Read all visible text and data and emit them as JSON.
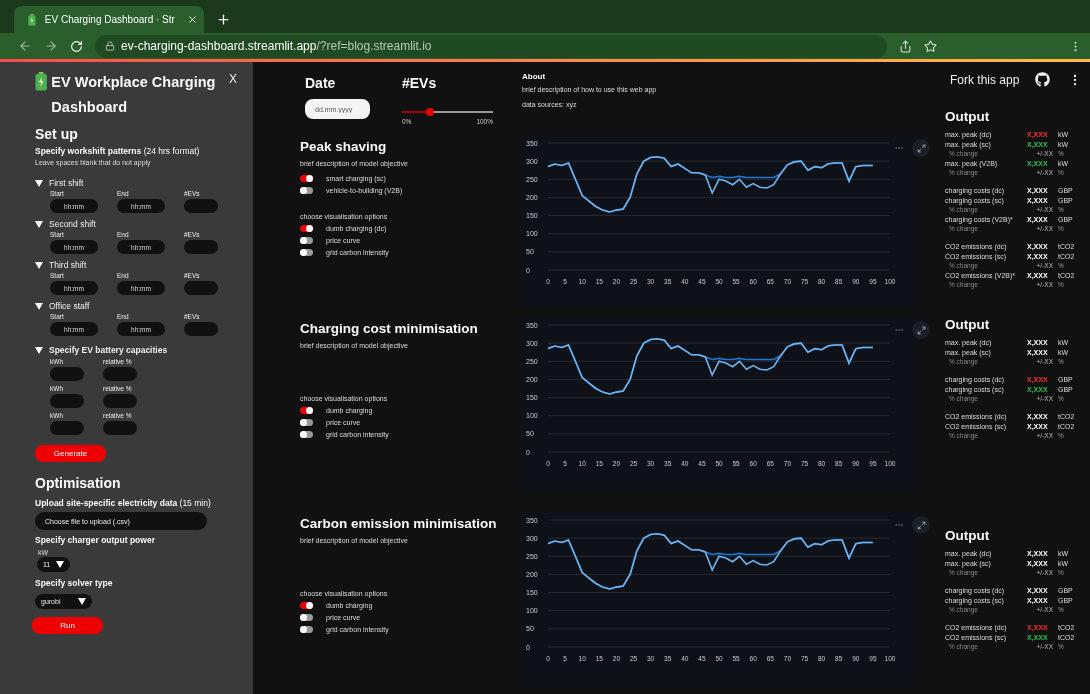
{
  "browser": {
    "tab_title": "EV Charging  Dashboard · Str",
    "url_host": "ev-charging-dashboard.streamlit.app",
    "url_path": "/?ref=blog.streamlit.io"
  },
  "sidebar": {
    "title": "EV Workplace Charging Dashboard",
    "close_label": "X",
    "setup_heading": "Set up",
    "workshift_label": "**Specify workshift patterns** (24 hrs format)",
    "workshift_hint": "Leave spaces blank that do not apply",
    "shifts": [
      {
        "name": "First shift",
        "expanded": true,
        "fields": [
          {
            "label": "Start",
            "placeholder": "hh:mm"
          },
          {
            "label": "End",
            "placeholder": "hh:mm"
          },
          {
            "label": "#EVs"
          }
        ]
      },
      {
        "name": "Second shift",
        "expanded": true,
        "fields": [
          {
            "label": "Start",
            "placeholder": "hh:mm"
          },
          {
            "label": "End",
            "placeholder": "hh:mm"
          },
          {
            "label": "#EVs"
          }
        ]
      },
      {
        "name": "Third shift",
        "expanded": true,
        "fields": [
          {
            "label": "Start",
            "placeholder": "hh:mm"
          },
          {
            "label": "End",
            "placeholder": "hh:mm"
          },
          {
            "label": "#EVs"
          }
        ]
      },
      {
        "name": "Office staff",
        "expanded": true,
        "fields": [
          {
            "label": "Start",
            "placeholder": "hh:mm"
          },
          {
            "label": "End",
            "placeholder": "hh:mm"
          },
          {
            "label": "#EVs"
          }
        ]
      }
    ],
    "battery": {
      "title": "Specify EV battery capacities",
      "expanded": true,
      "rows": [
        {
          "fields": [
            {
              "label": "kWh"
            },
            {
              "label": "relative %"
            }
          ]
        },
        {
          "fields": [
            {
              "label": "kWh"
            },
            {
              "label": "relative %"
            }
          ]
        },
        {
          "fields": [
            {
              "label": "kWh"
            },
            {
              "label": "relative %"
            }
          ]
        }
      ]
    },
    "generate_button": "Generate",
    "optimisation_heading": "Optimisation",
    "upload_label": "**Upload site-specific electricity data** (15 min)",
    "upload_button": "Choose file to upload (.csv)",
    "power_label": "Specify charger output power",
    "power_unit": "kW",
    "power_value": "11",
    "solver_label": "Specify solver type",
    "solver_value": "gurobi",
    "run_button": "Run"
  },
  "header": {
    "date_label": "Date",
    "date_placeholder": "dd.mm.yyyy",
    "evs_label": "#EVs",
    "evs_slider": {
      "level": 0.31,
      "min_label": "0%",
      "max_label": "100%"
    },
    "about_title": "About",
    "about_text": "brief description of how to use this web app",
    "about_sources": "data sources: xyz",
    "fork_label": "Fork this app"
  },
  "sections": [
    {
      "title": "Peak shaving",
      "description": "brief description of model objective",
      "options": [
        {
          "label": "smart charging (sc)",
          "on": true
        },
        {
          "label": "vehicle-to-building (V2B)",
          "on": false
        }
      ],
      "visualisation_heading": "choose visualisation options",
      "visualisation_options": [
        {
          "label": "dumb charging (dc)",
          "on": true
        },
        {
          "label": "price curve",
          "on": false
        },
        {
          "label": "grid carbon intensity",
          "on": false
        }
      ],
      "chart_data": {
        "type": "line",
        "x": [
          0,
          2,
          4,
          6,
          8,
          10,
          12,
          14,
          16,
          18,
          20,
          22,
          24,
          26,
          28,
          30,
          32,
          34,
          36,
          38,
          40,
          42,
          44,
          46,
          48,
          50,
          52,
          54,
          56,
          58,
          60,
          62,
          64,
          66,
          68,
          70,
          72,
          74,
          76,
          78,
          80,
          82,
          84,
          86,
          88,
          90,
          92,
          95
        ],
        "series": [
          {
            "color": "#1f77d0",
            "values": [
              285,
              292,
              288,
              295,
              250,
              205,
              190,
              175,
              165,
              160,
              165,
              168,
              200,
              265,
              300,
              310,
              312,
              308,
              285,
              292,
              280,
              268,
              268,
              262,
              255,
              258,
              255,
              255,
              258,
              255,
              255,
              255,
              255,
              255,
              265,
              290,
              298,
              300,
              275,
              285,
              282,
              293,
              295,
              295,
              245,
              285,
              288,
              288
            ]
          },
          {
            "color": "#6cb4ee",
            "values": [
              285,
              292,
              288,
              295,
              250,
              205,
              190,
              175,
              165,
              160,
              165,
              168,
              200,
              265,
              300,
              310,
              312,
              308,
              285,
              292,
              280,
              268,
              268,
              262,
              212,
              250,
              245,
              235,
              250,
              228,
              238,
              228,
              226,
              235,
              265,
              290,
              298,
              300,
              275,
              285,
              282,
              293,
              295,
              295,
              245,
              285,
              288,
              288
            ]
          }
        ],
        "xlim": [
          0,
          100
        ],
        "ylim": [
          0,
          350
        ],
        "xticks": [
          0,
          5,
          10,
          15,
          20,
          25,
          30,
          35,
          40,
          45,
          50,
          55,
          60,
          65,
          70,
          75,
          80,
          85,
          90,
          95,
          100
        ],
        "yticks": [
          0,
          50,
          100,
          150,
          200,
          250,
          300,
          350
        ],
        "grid": true
      }
    },
    {
      "title": "Charging cost minimisation",
      "description": "brief description of model objective",
      "visualisation_heading": "choose visualisation options",
      "visualisation_options": [
        {
          "label": "dumb charging",
          "on": true
        },
        {
          "label": "price curve",
          "on": false
        },
        {
          "label": "grid carbon intensity",
          "on": false
        }
      ],
      "chart_data": {
        "type": "line",
        "x": [
          0,
          2,
          4,
          6,
          8,
          10,
          12,
          14,
          16,
          18,
          20,
          22,
          24,
          26,
          28,
          30,
          32,
          34,
          36,
          38,
          40,
          42,
          44,
          46,
          48,
          50,
          52,
          54,
          56,
          58,
          60,
          62,
          64,
          66,
          68,
          70,
          72,
          74,
          76,
          78,
          80,
          82,
          84,
          86,
          88,
          90,
          92,
          95
        ],
        "series": [
          {
            "color": "#1f77d0",
            "values": [
              285,
              292,
              288,
              295,
              250,
              205,
              190,
              175,
              165,
              160,
              165,
              168,
              200,
              265,
              300,
              310,
              312,
              308,
              285,
              292,
              280,
              268,
              268,
              262,
              255,
              258,
              255,
              255,
              258,
              255,
              255,
              255,
              255,
              255,
              265,
              290,
              298,
              300,
              275,
              285,
              282,
              293,
              295,
              295,
              245,
              285,
              288,
              288
            ]
          },
          {
            "color": "#6cb4ee",
            "values": [
              285,
              292,
              288,
              295,
              250,
              205,
              190,
              175,
              165,
              160,
              165,
              168,
              200,
              265,
              300,
              310,
              312,
              308,
              285,
              292,
              280,
              268,
              268,
              262,
              212,
              250,
              245,
              235,
              250,
              228,
              238,
              228,
              226,
              235,
              265,
              290,
              298,
              300,
              275,
              285,
              282,
              293,
              295,
              295,
              245,
              285,
              288,
              288
            ]
          }
        ],
        "xlim": [
          0,
          100
        ],
        "ylim": [
          0,
          350
        ],
        "xticks": [
          0,
          5,
          10,
          15,
          20,
          25,
          30,
          35,
          40,
          45,
          50,
          55,
          60,
          65,
          70,
          75,
          80,
          85,
          90,
          95,
          100
        ],
        "yticks": [
          0,
          50,
          100,
          150,
          200,
          250,
          300,
          350
        ],
        "grid": true
      }
    },
    {
      "title": "Carbon emission minimisation",
      "description": "brief description of model objective",
      "visualisation_heading": "choose visualisation options",
      "visualisation_options": [
        {
          "label": "dumb charging",
          "on": true
        },
        {
          "label": "price curve",
          "on": false
        },
        {
          "label": "grid carbon intensity",
          "on": false
        }
      ],
      "chart_data": {
        "type": "line",
        "x": [
          0,
          2,
          4,
          6,
          8,
          10,
          12,
          14,
          16,
          18,
          20,
          22,
          24,
          26,
          28,
          30,
          32,
          34,
          36,
          38,
          40,
          42,
          44,
          46,
          48,
          50,
          52,
          54,
          56,
          58,
          60,
          62,
          64,
          66,
          68,
          70,
          72,
          74,
          76,
          78,
          80,
          82,
          84,
          86,
          88,
          90,
          92,
          95
        ],
        "series": [
          {
            "color": "#1f77d0",
            "values": [
              285,
              292,
              288,
              295,
              250,
              205,
              190,
              175,
              165,
              160,
              165,
              168,
              200,
              265,
              300,
              310,
              312,
              308,
              285,
              292,
              280,
              268,
              268,
              262,
              255,
              258,
              255,
              255,
              258,
              255,
              255,
              255,
              255,
              255,
              265,
              290,
              298,
              300,
              275,
              285,
              282,
              293,
              295,
              295,
              245,
              285,
              288,
              288
            ]
          },
          {
            "color": "#6cb4ee",
            "values": [
              285,
              292,
              288,
              295,
              250,
              205,
              190,
              175,
              165,
              160,
              165,
              168,
              200,
              265,
              300,
              310,
              312,
              308,
              285,
              292,
              280,
              268,
              268,
              262,
              212,
              250,
              245,
              235,
              250,
              228,
              238,
              228,
              226,
              235,
              265,
              290,
              298,
              300,
              275,
              285,
              282,
              293,
              295,
              295,
              245,
              285,
              288,
              288
            ]
          }
        ],
        "xlim": [
          0,
          100
        ],
        "ylim": [
          0,
          350
        ],
        "xticks": [
          0,
          5,
          10,
          15,
          20,
          25,
          30,
          35,
          40,
          45,
          50,
          55,
          60,
          65,
          70,
          75,
          80,
          85,
          90,
          95,
          100
        ],
        "yticks": [
          0,
          50,
          100,
          150,
          200,
          250,
          300,
          350
        ],
        "grid": true
      }
    }
  ],
  "outputs": [
    {
      "title": "Output",
      "groups": [
        {
          "rows": [
            {
              "kind": "metric",
              "label": "max. peak (dc)",
              "value": "X,XXX",
              "unit": "kW",
              "color": "#ff2b2b"
            },
            {
              "kind": "metric",
              "label": "max. peak (sc)",
              "value": "X,XXX",
              "unit": "kW",
              "color": "#21c354"
            },
            {
              "kind": "change",
              "label": "% change",
              "value": "+/-XX",
              "unit": "%"
            },
            {
              "kind": "metric",
              "label": "max. peak (V2B)",
              "value": "X,XXX",
              "unit": "kW",
              "color": "#21c354"
            },
            {
              "kind": "change",
              "label": "% change",
              "value": "+/-XX",
              "unit": "%"
            }
          ]
        },
        {
          "rows": [
            {
              "kind": "metric",
              "label": "charging costs (dc)",
              "value": "X,XXX",
              "unit": "GBP",
              "color": "#ffffff"
            },
            {
              "kind": "metric",
              "label": "charging costs (sc)",
              "value": "X,XXX",
              "unit": "GBP",
              "color": "#ffffff"
            },
            {
              "kind": "change",
              "label": "% change",
              "value": "+/-XX",
              "unit": "%"
            },
            {
              "kind": "metric",
              "label": "charging costs (V2B)*",
              "value": "X,XXX",
              "unit": "GBP",
              "color": "#ffffff"
            },
            {
              "kind": "change",
              "label": "% change",
              "value": "+/-XX",
              "unit": "%"
            }
          ]
        },
        {
          "rows": [
            {
              "kind": "metric",
              "label": "CO2 emissions (dc)",
              "value": "X,XXX",
              "unit": "tCO2",
              "color": "#ffffff"
            },
            {
              "kind": "metric",
              "label": "CO2 emissions (sc)",
              "value": "X,XXX",
              "unit": "tCO2",
              "color": "#ffffff"
            },
            {
              "kind": "change",
              "label": "% change",
              "value": "+/-XX",
              "unit": "%"
            },
            {
              "kind": "metric",
              "label": "CO2 emissions (V2B)*",
              "value": "X,XXX",
              "unit": "tCO2",
              "color": "#ffffff"
            },
            {
              "kind": "change",
              "label": "% change",
              "value": "+/-XX",
              "unit": "%"
            }
          ]
        }
      ]
    },
    {
      "title": "Output",
      "groups": [
        {
          "rows": [
            {
              "kind": "metric",
              "label": "max. peak (dc)",
              "value": "X,XXX",
              "unit": "kW",
              "color": "#ffffff"
            },
            {
              "kind": "metric",
              "label": "max. peak (sc)",
              "value": "X,XXX",
              "unit": "kW",
              "color": "#ffffff"
            },
            {
              "kind": "change",
              "label": "% change",
              "value": "+/-XX",
              "unit": "%"
            }
          ]
        },
        {
          "rows": [
            {
              "kind": "metric",
              "label": "charging costs (dc)",
              "value": "X,XXX",
              "unit": "GBP",
              "color": "#ff2b2b"
            },
            {
              "kind": "metric",
              "label": "charging costs (sc)",
              "value": "X,XXX",
              "unit": "GBP",
              "color": "#21c354"
            },
            {
              "kind": "change",
              "label": "% change",
              "value": "+/-XX",
              "unit": "%"
            }
          ]
        },
        {
          "rows": [
            {
              "kind": "metric",
              "label": "CO2 emissions (dc)",
              "value": "X,XXX",
              "unit": "tCO2",
              "color": "#ffffff"
            },
            {
              "kind": "metric",
              "label": "CO2 emissions (sc)",
              "value": "X,XXX",
              "unit": "tCO2",
              "color": "#ffffff"
            },
            {
              "kind": "change",
              "label": "% change",
              "value": "+/-XX",
              "unit": "%"
            }
          ]
        }
      ]
    },
    {
      "title": "Output",
      "groups": [
        {
          "rows": [
            {
              "kind": "metric",
              "label": "max. peak (dc)",
              "value": "X,XXX",
              "unit": "kW",
              "color": "#ffffff"
            },
            {
              "kind": "metric",
              "label": "max. peak (sc)",
              "value": "X,XXX",
              "unit": "kW",
              "color": "#ffffff"
            },
            {
              "kind": "change",
              "label": "% change",
              "value": "+/-XX",
              "unit": "%"
            }
          ]
        },
        {
          "rows": [
            {
              "kind": "metric",
              "label": "charging costs (dc)",
              "value": "X,XXX",
              "unit": "GBP",
              "color": "#ffffff"
            },
            {
              "kind": "metric",
              "label": "charging costs (sc)",
              "value": "X,XXX",
              "unit": "GBP",
              "color": "#ffffff"
            },
            {
              "kind": "change",
              "label": "% change",
              "value": "+/-XX",
              "unit": "%"
            }
          ]
        },
        {
          "rows": [
            {
              "kind": "metric",
              "label": "CO2 emissions (dc)",
              "value": "X,XXX",
              "unit": "tCO2",
              "color": "#ff2b2b"
            },
            {
              "kind": "metric",
              "label": "CO2 emissions (sc)",
              "value": "X,XXX",
              "unit": "tCO2",
              "color": "#21c354"
            },
            {
              "kind": "change",
              "label": "% change",
              "value": "+/-XX",
              "unit": "%"
            }
          ]
        }
      ]
    }
  ]
}
